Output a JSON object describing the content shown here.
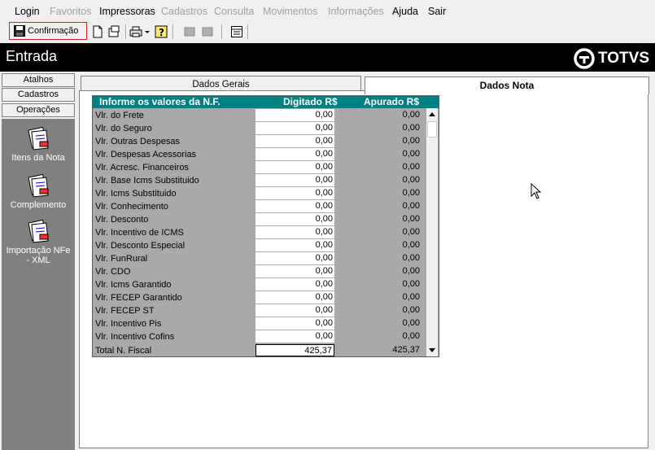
{
  "menu": {
    "items": [
      {
        "label": "Login",
        "disabled": false
      },
      {
        "label": "Favoritos",
        "disabled": true
      },
      {
        "label": "Impressoras",
        "disabled": false
      },
      {
        "label": "Cadastros",
        "disabled": true
      },
      {
        "label": "Consulta",
        "disabled": true
      },
      {
        "label": "Movimentos",
        "disabled": true
      },
      {
        "label": "Informações",
        "disabled": true
      },
      {
        "label": "Ajuda",
        "disabled": false
      },
      {
        "label": "Sair",
        "disabled": false
      }
    ]
  },
  "toolbar": {
    "confirm_label": "Confirmação",
    "icons": [
      "save-icon",
      "new-document-icon",
      "open-icon",
      "print-icon",
      "dropdown-arrow-icon",
      "help-icon",
      "tool1-icon",
      "tool2-icon",
      "calendar-icon"
    ]
  },
  "title": {
    "text": "Entrada"
  },
  "logo": {
    "text": "TOTVS"
  },
  "left_panel": {
    "tabs": [
      "Atalhos",
      "Cadastros",
      "Operações"
    ],
    "items": [
      "Itens da Nota",
      "Complemento",
      "Importação NFe - XML"
    ]
  },
  "tabs": {
    "tab1": "Dados Gerais",
    "tab2": "Dados Nota"
  },
  "grid": {
    "header": {
      "title": "Informe os valores da N.F.",
      "digitado": "Digitado  R$",
      "apurado": "Apurado  R$"
    },
    "rows": [
      {
        "label": "Vlr. do Frete",
        "dig": "0,00",
        "apu": "0,00"
      },
      {
        "label": "Vlr. do Seguro",
        "dig": "0,00",
        "apu": "0,00"
      },
      {
        "label": "Vlr. Outras Despesas",
        "dig": "0,00",
        "apu": "0,00"
      },
      {
        "label": "Vlr. Despesas Acessorias",
        "dig": "0,00",
        "apu": "0,00"
      },
      {
        "label": "Vlr. Acresc. Financeiros",
        "dig": "0,00",
        "apu": "0,00"
      },
      {
        "label": "Vlr. Base Icms Substituido",
        "dig": "0,00",
        "apu": "0,00"
      },
      {
        "label": "Vlr. Icms Substituido",
        "dig": "0,00",
        "apu": "0,00"
      },
      {
        "label": "Vlr. Conhecimento",
        "dig": "0,00",
        "apu": "0,00"
      },
      {
        "label": "Vlr. Desconto",
        "dig": "0,00",
        "apu": "0,00"
      },
      {
        "label": "Vlr. Incentivo de ICMS",
        "dig": "0,00",
        "apu": "0,00"
      },
      {
        "label": "Vlr. Desconto Especial",
        "dig": "0,00",
        "apu": "0,00"
      },
      {
        "label": "Vlr. FunRural",
        "dig": "0,00",
        "apu": "0,00"
      },
      {
        "label": "Vlr. CDO",
        "dig": "0,00",
        "apu": "0,00"
      },
      {
        "label": "Vlr. Icms Garantido",
        "dig": "0,00",
        "apu": "0,00"
      },
      {
        "label": "Vlr. FECEP Garantido",
        "dig": "0,00",
        "apu": "0,00"
      },
      {
        "label": "Vlr. FECEP ST",
        "dig": "0,00",
        "apu": "0,00"
      },
      {
        "label": "Vlr. Incentivo Pis",
        "dig": "0,00",
        "apu": "0,00"
      },
      {
        "label": "Vlr. Incentivo Cofins",
        "dig": "0,00",
        "apu": "0,00"
      }
    ],
    "total": {
      "label": "Total N. Fiscal",
      "dig": "425,37",
      "apu": "425,37"
    }
  }
}
